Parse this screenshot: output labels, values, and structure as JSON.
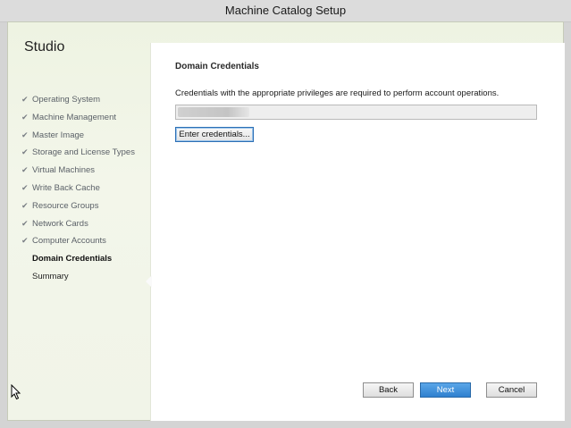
{
  "window": {
    "title": "Machine Catalog Setup"
  },
  "sidebar": {
    "title": "Studio",
    "steps": [
      {
        "label": "Operating System",
        "state": "done"
      },
      {
        "label": "Machine Management",
        "state": "done"
      },
      {
        "label": "Master Image",
        "state": "done"
      },
      {
        "label": "Storage and License Types",
        "state": "done"
      },
      {
        "label": "Virtual Machines",
        "state": "done"
      },
      {
        "label": "Write Back Cache",
        "state": "done"
      },
      {
        "label": "Resource Groups",
        "state": "done"
      },
      {
        "label": "Network Cards",
        "state": "done"
      },
      {
        "label": "Computer Accounts",
        "state": "done"
      },
      {
        "label": "Domain Credentials",
        "state": "current"
      },
      {
        "label": "Summary",
        "state": "pending"
      }
    ],
    "check_glyph": "✔"
  },
  "main": {
    "title": "Domain Credentials",
    "description": "Credentials with the appropriate privileges are required to perform account operations.",
    "credentials_value": "",
    "enter_credentials_label": "Enter credentials..."
  },
  "footer": {
    "back_label": "Back",
    "next_label": "Next",
    "cancel_label": "Cancel"
  },
  "colors": {
    "accent": "#2f80cf",
    "sidebar_bg": "#eef3e2"
  }
}
